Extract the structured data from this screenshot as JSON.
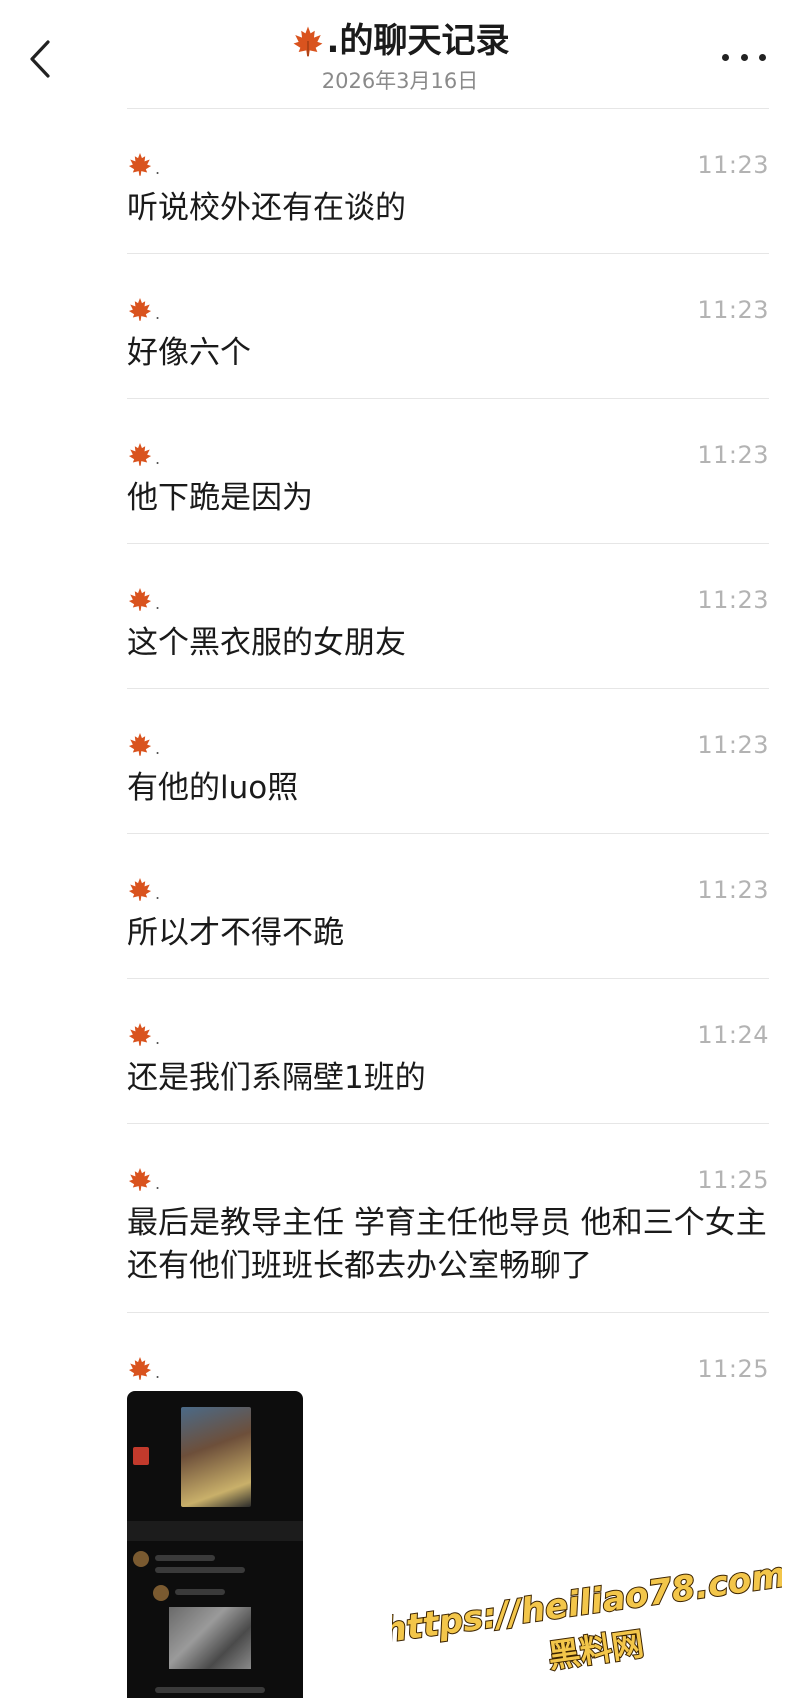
{
  "header": {
    "title": ".的聊天记录",
    "title_icon": "maple-leaf-icon",
    "date": "2026年3月16日"
  },
  "messages": [
    {
      "sender": ".",
      "time": "11:23",
      "text": "听说校外还有在谈的"
    },
    {
      "sender": ".",
      "time": "11:23",
      "text": "好像六个"
    },
    {
      "sender": ".",
      "time": "11:23",
      "text": "他下跪是因为"
    },
    {
      "sender": ".",
      "time": "11:23",
      "text": "这个黑衣服的女朋友"
    },
    {
      "sender": ".",
      "time": "11:23",
      "text": "有他的luo照"
    },
    {
      "sender": ".",
      "time": "11:23",
      "text": "所以才不得不跪"
    },
    {
      "sender": ".",
      "time": "11:24",
      "text": "还是我们系隔壁1班的"
    },
    {
      "sender": ".",
      "time": "11:25",
      "text": "最后是教导主任 学育主任他导员 他和三个女主还有他们班班长都去办公室畅聊了"
    },
    {
      "sender": ".",
      "time": "11:25",
      "image": "chat-screenshot-image"
    }
  ],
  "watermark": {
    "url": "https://heiliao78.com",
    "name": "黑料网"
  },
  "colors": {
    "leaf": "#d9531e",
    "text": "#1a1a1a",
    "time": "#b3b3b3",
    "watermark_fill": "#f3c64a",
    "watermark_stroke": "#3a2200"
  }
}
